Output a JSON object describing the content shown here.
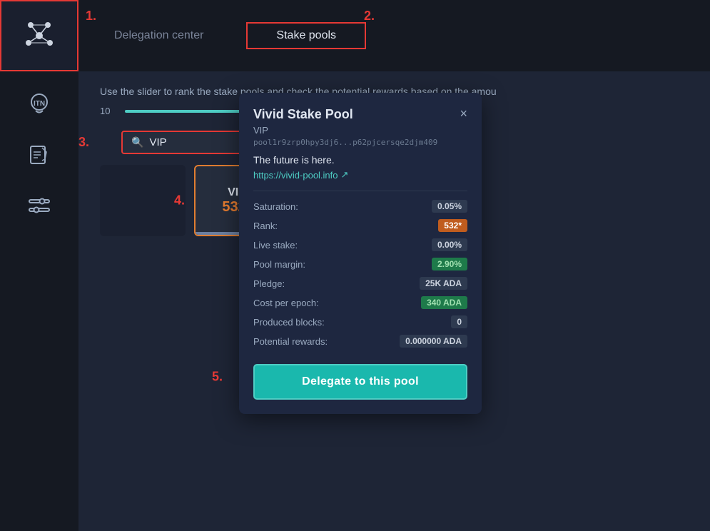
{
  "sidebar": {
    "logo_alt": "Daedalus logo"
  },
  "topbar": {
    "delegation_center_tab": "Delegation center",
    "stake_pools_tab": "Stake pools"
  },
  "main": {
    "slider_description": "Use the slider to rank the stake pools and check the potential rewards based on the amou",
    "slider_value": "10",
    "search_placeholder": "VIP",
    "search_label": "Stake pools. Search"
  },
  "pool_card": {
    "name": "VIP",
    "rank": "532*"
  },
  "modal": {
    "title": "Vivid Stake Pool",
    "close_label": "×",
    "subtitle": "VIP",
    "pool_id": "pool1r9zrp0hpy3dj6...p62pjcersqe2djm409",
    "tagline": "The future is here.",
    "link": "https://vivid-pool.info",
    "link_icon": "↗",
    "saturation_label": "Saturation:",
    "saturation_value": "0.05%",
    "rank_label": "Rank:",
    "rank_value": "532*",
    "live_stake_label": "Live stake:",
    "live_stake_value": "0.00%",
    "pool_margin_label": "Pool margin:",
    "pool_margin_value": "2.90%",
    "pledge_label": "Pledge:",
    "pledge_value": "25K ADA",
    "cost_label": "Cost per epoch:",
    "cost_value": "340 ADA",
    "produced_label": "Produced blocks:",
    "produced_value": "0",
    "potential_label": "Potential rewards:",
    "potential_value": "0.000000 ADA",
    "delegate_btn": "Delegate to this pool"
  },
  "annotations": {
    "label_1": "1.",
    "label_2": "2.",
    "label_3": "3.",
    "label_4": "4.",
    "label_5": "5."
  }
}
